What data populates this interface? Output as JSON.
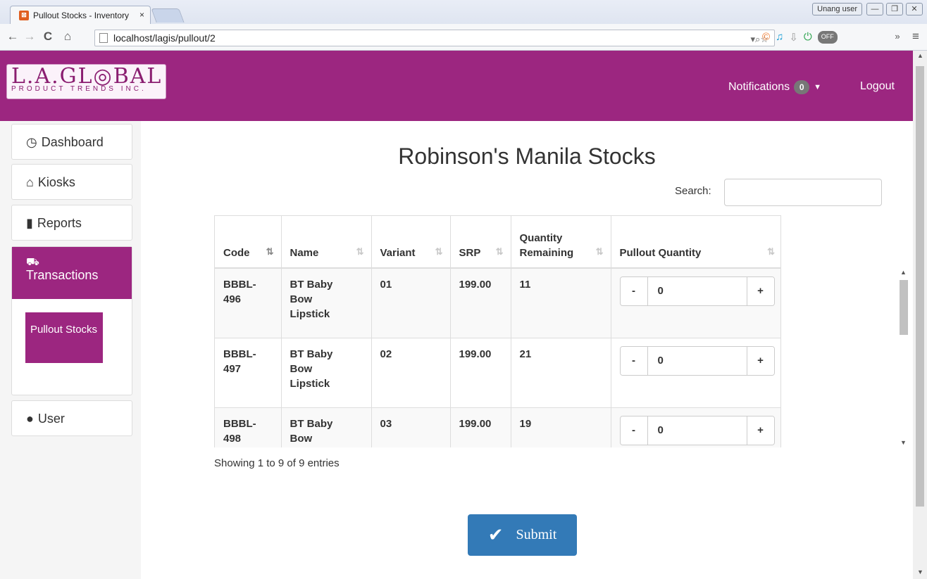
{
  "browser": {
    "tab_title": "Pullout Stocks - Inventory",
    "tab_close": "×",
    "url": "localhost/lagis/pullout/2",
    "profile": "Unang user",
    "win_min": "—",
    "win_max": "❐",
    "win_close": "✕",
    "nav_back": "←",
    "nav_forward": "→",
    "nav_reload": "C",
    "nav_home": "⌂",
    "omni_actions": "▾⌕☆",
    "more": "»",
    "menu": "≡",
    "ext_off": "OFF"
  },
  "header": {
    "logo_big": "L.A.GL◎BAL",
    "logo_small": "PRODUCT TRENDS INC.",
    "notifications_label": "Notifications",
    "notifications_count": "0",
    "logout_label": "Logout"
  },
  "sidebar": {
    "dashboard": "Dashboard",
    "kiosks": "Kiosks",
    "reports": "Reports",
    "transactions": "Transactions",
    "pullout_stocks": "Pullout Stocks",
    "user": "User"
  },
  "main": {
    "title": "Robinson's Manila Stocks",
    "search_label": "Search:",
    "search_value": "",
    "columns": [
      "Code",
      "Name",
      "Variant",
      "SRP",
      "Quantity Remaining",
      "Pullout Quantity"
    ],
    "rows": [
      {
        "code": "BBBL-496",
        "name": "BT Baby Bow Lipstick",
        "variant": "01",
        "srp": "199.00",
        "qty": "11",
        "pullout": "0"
      },
      {
        "code": "BBBL-497",
        "name": "BT Baby Bow Lipstick",
        "variant": "02",
        "srp": "199.00",
        "qty": "21",
        "pullout": "0"
      },
      {
        "code": "BBBL-498",
        "name": "BT Baby Bow",
        "variant": "03",
        "srp": "199.00",
        "qty": "19",
        "pullout": "0"
      }
    ],
    "minus": "-",
    "plus": "+",
    "entries_info": "Showing 1 to 9 of 9 entries",
    "submit_label": "Submit"
  }
}
